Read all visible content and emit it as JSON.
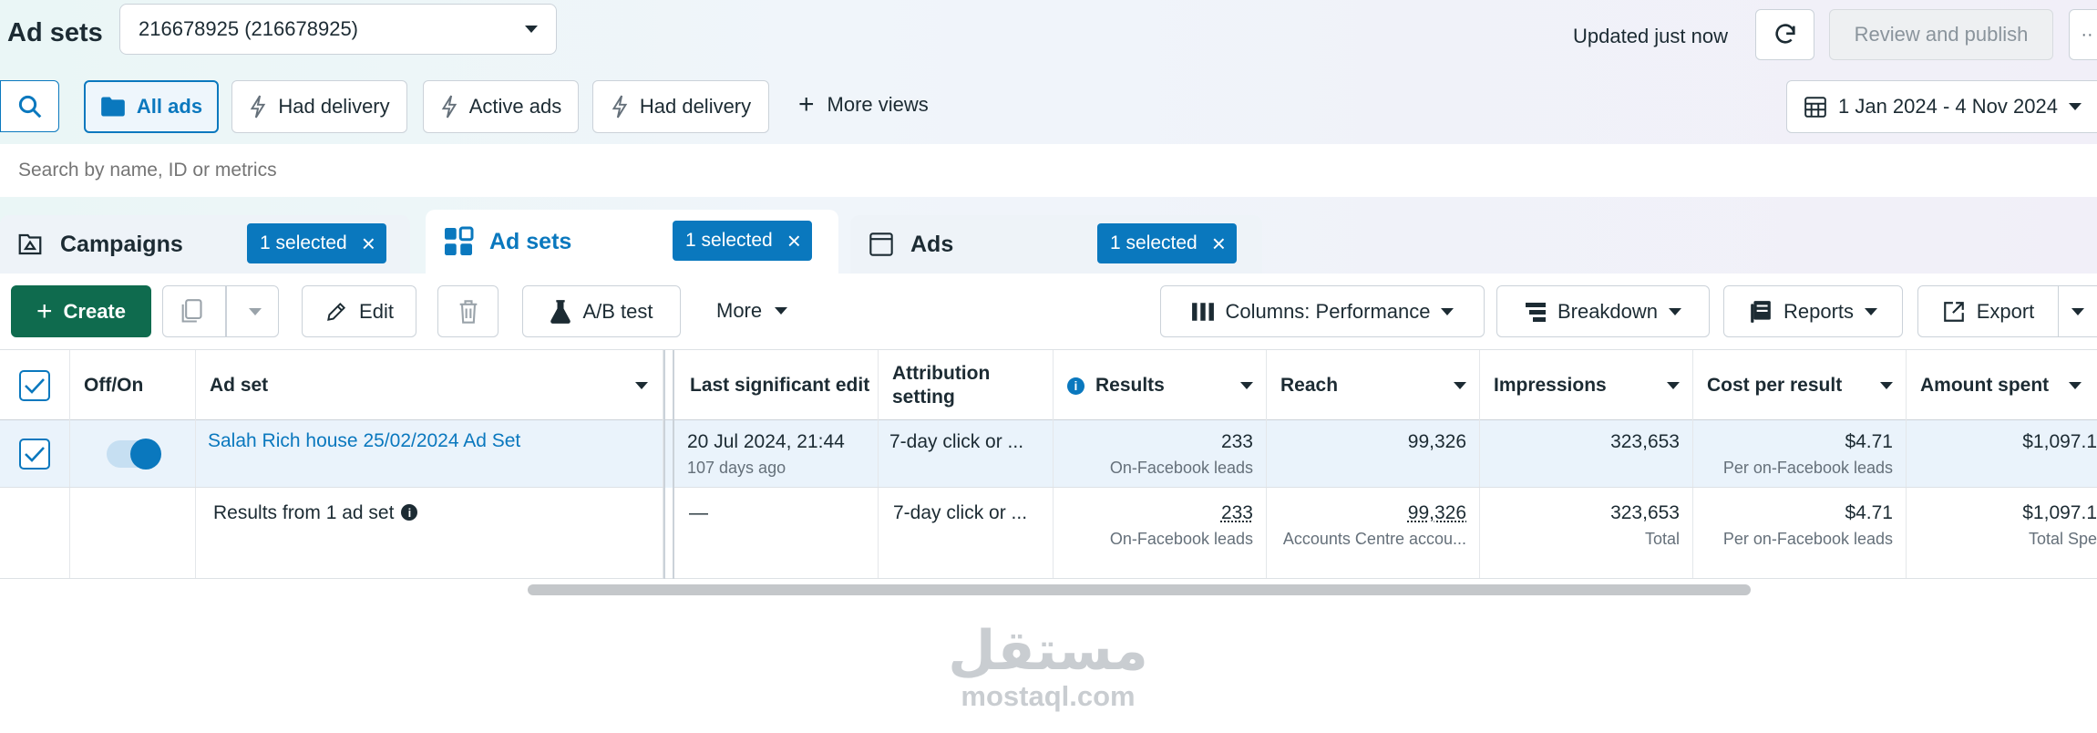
{
  "header": {
    "title": "Ad sets",
    "account_select": "216678925 (216678925)",
    "updated": "Updated just now",
    "review_publish": "Review and publish"
  },
  "views": {
    "all_ads": "All ads",
    "had_delivery_1": "Had delivery",
    "active_ads": "Active ads",
    "had_delivery_2": "Had delivery",
    "more_views": "More views",
    "date_range": "1 Jan 2024 - 4 Nov 2024"
  },
  "search": {
    "placeholder": "Search by name, ID or metrics"
  },
  "tabs": {
    "campaigns": "Campaigns",
    "adsets": "Ad sets",
    "ads": "Ads",
    "selected": "1 selected"
  },
  "toolbar": {
    "create": "Create",
    "edit": "Edit",
    "ab_test": "A/B test",
    "more": "More",
    "columns": "Columns: Performance",
    "breakdown": "Breakdown",
    "reports": "Reports",
    "export": "Export"
  },
  "columns": {
    "offon": "Off/On",
    "adset": "Ad set",
    "last_edit": "Last significant edit",
    "attribution": "Attribution setting",
    "results": "Results",
    "reach": "Reach",
    "impressions": "Impressions",
    "cpr": "Cost per result",
    "spent": "Amount spent"
  },
  "row1": {
    "name": "Salah Rich house 25/02/2024 Ad Set",
    "edit": "20 Jul 2024, 21:44",
    "edit_ago": "107 days ago",
    "attribution": "7-day click or ...",
    "results": "233",
    "results_sub": "On-Facebook leads",
    "reach": "99,326",
    "impressions": "323,653",
    "cpr": "$4.71",
    "cpr_sub": "Per on-Facebook leads",
    "spent": "$1,097.1"
  },
  "summary": {
    "label": "Results from 1 ad set",
    "edit": "—",
    "attribution": "7-day click or ...",
    "results": "233",
    "results_sub": "On-Facebook leads",
    "reach": "99,326",
    "reach_sub": "Accounts Centre accou...",
    "impressions": "323,653",
    "impressions_sub": "Total",
    "cpr": "$4.71",
    "cpr_sub": "Per on-Facebook leads",
    "spent": "$1,097.1",
    "spent_sub": "Total Spe"
  },
  "watermark": {
    "arabic": "مستقل",
    "latin": "mostaql.com"
  },
  "colors": {
    "primary": "#0a78be",
    "create": "#0f6b4e",
    "row_selected": "#eaf3fb"
  }
}
